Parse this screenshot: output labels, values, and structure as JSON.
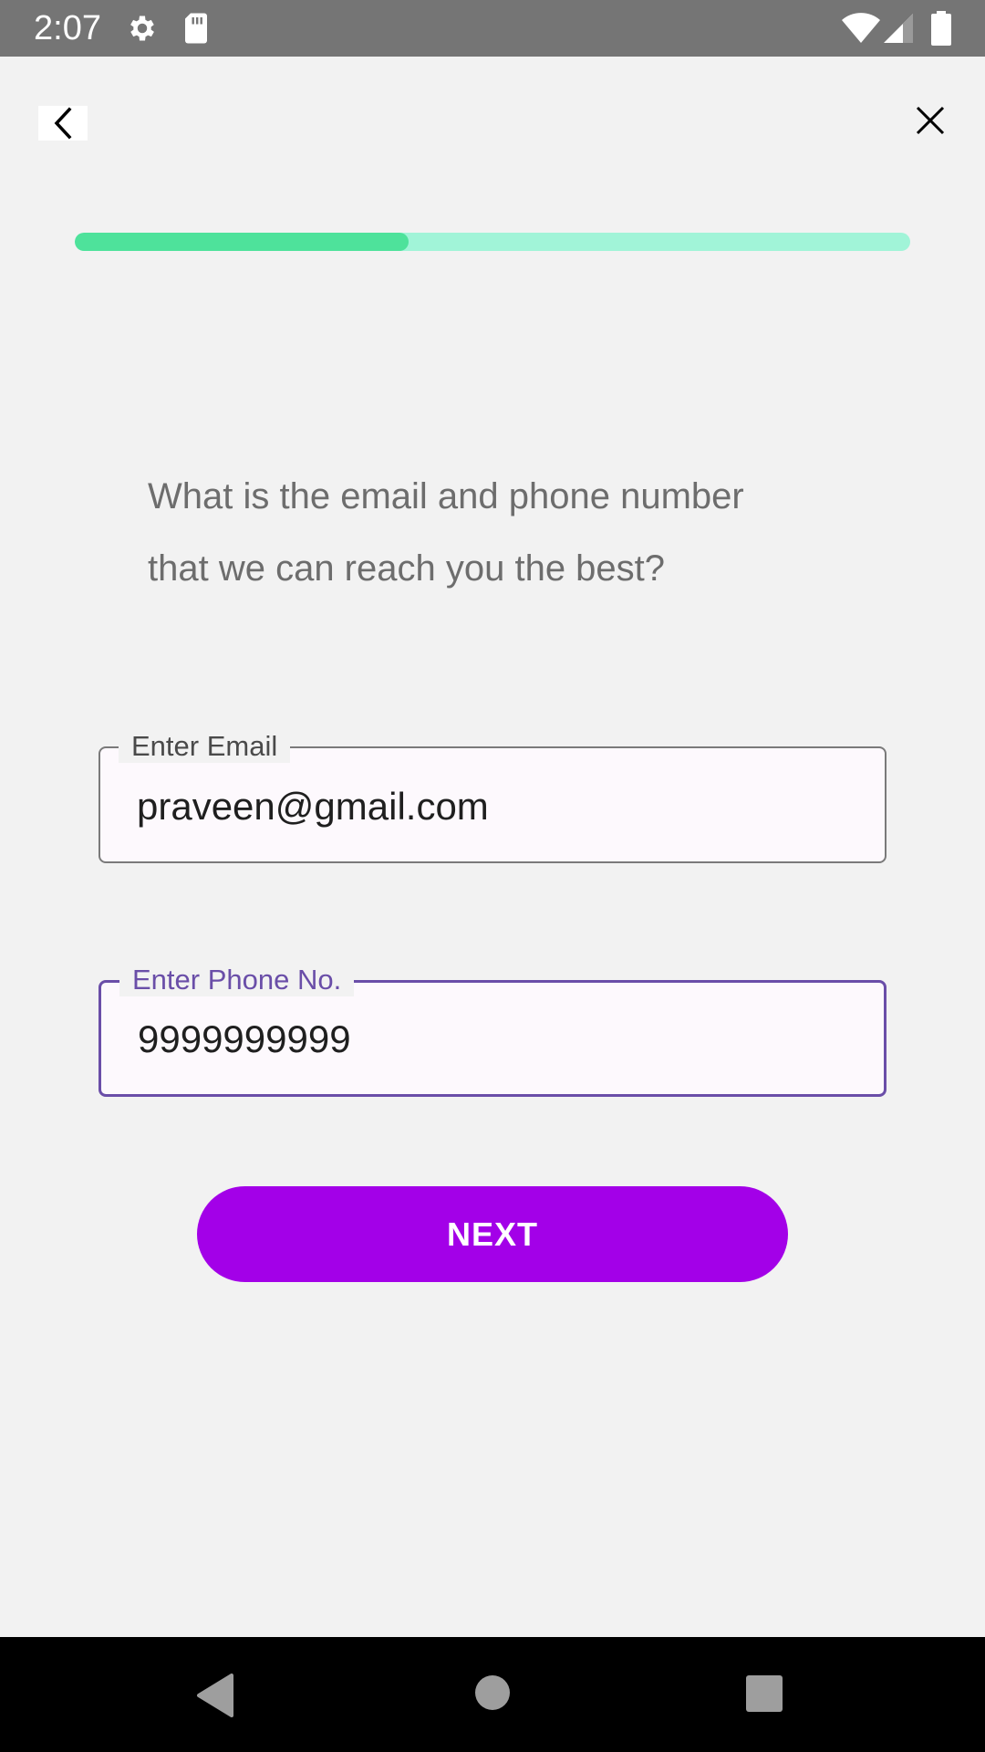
{
  "status_bar": {
    "time": "2:07",
    "icons": [
      "gear-icon",
      "sd-card-icon",
      "wifi-icon",
      "signal-icon",
      "battery-icon"
    ]
  },
  "header": {
    "back_icon": "chevron-left-icon",
    "close_icon": "close-icon"
  },
  "progress": {
    "fraction": 0.4
  },
  "question": {
    "line1": "What is the email and phone number",
    "line2": "that we can reach you the best?"
  },
  "form": {
    "email": {
      "label": "Enter Email",
      "value": "praveen@gmail.com"
    },
    "phone": {
      "label": "Enter Phone No.",
      "value": "9999999999"
    }
  },
  "actions": {
    "next_label": "NEXT"
  },
  "nav_bar": {
    "icons": [
      "nav-back-icon",
      "nav-home-icon",
      "nav-recents-icon"
    ]
  },
  "colors": {
    "accent": "#a300e8",
    "focus": "#6a4ea8",
    "progress_fill": "#4ee29b",
    "progress_track": "#a1f4d8",
    "background": "#f2f2f2"
  }
}
